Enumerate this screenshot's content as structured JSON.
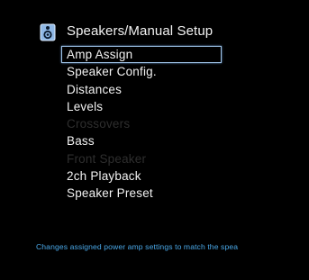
{
  "header": {
    "title": "Speakers/Manual Setup",
    "icon": "speaker-icon"
  },
  "menu": {
    "items": [
      {
        "label": "Amp Assign",
        "state": "selected"
      },
      {
        "label": "Speaker Config.",
        "state": "enabled"
      },
      {
        "label": "Distances",
        "state": "enabled"
      },
      {
        "label": "Levels",
        "state": "enabled"
      },
      {
        "label": "Crossovers",
        "state": "disabled"
      },
      {
        "label": "Bass",
        "state": "enabled"
      },
      {
        "label": "Front Speaker",
        "state": "disabled"
      },
      {
        "label": "2ch Playback",
        "state": "enabled"
      },
      {
        "label": "Speaker Preset",
        "state": "enabled"
      }
    ]
  },
  "status": {
    "text": "Changes assigned power amp settings to match the spea"
  },
  "colors": {
    "background": "#000000",
    "text": "#f2f2f2",
    "disabled_text": "#2e2e2e",
    "highlight_border": "#9fc3e8",
    "status_text": "#4aa8e8"
  }
}
